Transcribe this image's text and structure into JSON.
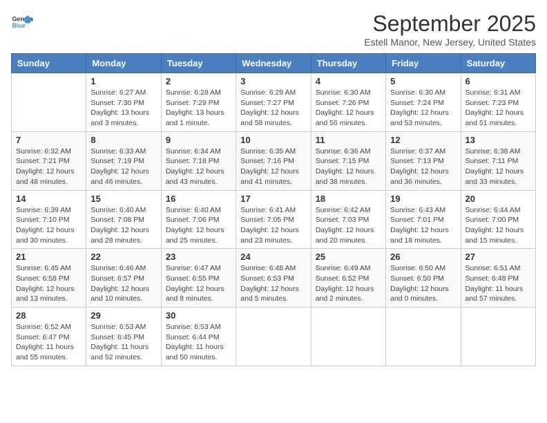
{
  "logo": {
    "text_general": "General",
    "text_blue": "Blue"
  },
  "header": {
    "month": "September 2025",
    "location": "Estell Manor, New Jersey, United States"
  },
  "days_of_week": [
    "Sunday",
    "Monday",
    "Tuesday",
    "Wednesday",
    "Thursday",
    "Friday",
    "Saturday"
  ],
  "weeks": [
    [
      {
        "day": "",
        "info": ""
      },
      {
        "day": "1",
        "info": "Sunrise: 6:27 AM\nSunset: 7:30 PM\nDaylight: 13 hours\nand 3 minutes."
      },
      {
        "day": "2",
        "info": "Sunrise: 6:28 AM\nSunset: 7:29 PM\nDaylight: 13 hours\nand 1 minute."
      },
      {
        "day": "3",
        "info": "Sunrise: 6:29 AM\nSunset: 7:27 PM\nDaylight: 12 hours\nand 58 minutes."
      },
      {
        "day": "4",
        "info": "Sunrise: 6:30 AM\nSunset: 7:26 PM\nDaylight: 12 hours\nand 56 minutes."
      },
      {
        "day": "5",
        "info": "Sunrise: 6:30 AM\nSunset: 7:24 PM\nDaylight: 12 hours\nand 53 minutes."
      },
      {
        "day": "6",
        "info": "Sunrise: 6:31 AM\nSunset: 7:23 PM\nDaylight: 12 hours\nand 51 minutes."
      }
    ],
    [
      {
        "day": "7",
        "info": "Sunrise: 6:32 AM\nSunset: 7:21 PM\nDaylight: 12 hours\nand 48 minutes."
      },
      {
        "day": "8",
        "info": "Sunrise: 6:33 AM\nSunset: 7:19 PM\nDaylight: 12 hours\nand 46 minutes."
      },
      {
        "day": "9",
        "info": "Sunrise: 6:34 AM\nSunset: 7:18 PM\nDaylight: 12 hours\nand 43 minutes."
      },
      {
        "day": "10",
        "info": "Sunrise: 6:35 AM\nSunset: 7:16 PM\nDaylight: 12 hours\nand 41 minutes."
      },
      {
        "day": "11",
        "info": "Sunrise: 6:36 AM\nSunset: 7:15 PM\nDaylight: 12 hours\nand 38 minutes."
      },
      {
        "day": "12",
        "info": "Sunrise: 6:37 AM\nSunset: 7:13 PM\nDaylight: 12 hours\nand 36 minutes."
      },
      {
        "day": "13",
        "info": "Sunrise: 6:38 AM\nSunset: 7:11 PM\nDaylight: 12 hours\nand 33 minutes."
      }
    ],
    [
      {
        "day": "14",
        "info": "Sunrise: 6:39 AM\nSunset: 7:10 PM\nDaylight: 12 hours\nand 30 minutes."
      },
      {
        "day": "15",
        "info": "Sunrise: 6:40 AM\nSunset: 7:08 PM\nDaylight: 12 hours\nand 28 minutes."
      },
      {
        "day": "16",
        "info": "Sunrise: 6:40 AM\nSunset: 7:06 PM\nDaylight: 12 hours\nand 25 minutes."
      },
      {
        "day": "17",
        "info": "Sunrise: 6:41 AM\nSunset: 7:05 PM\nDaylight: 12 hours\nand 23 minutes."
      },
      {
        "day": "18",
        "info": "Sunrise: 6:42 AM\nSunset: 7:03 PM\nDaylight: 12 hours\nand 20 minutes."
      },
      {
        "day": "19",
        "info": "Sunrise: 6:43 AM\nSunset: 7:01 PM\nDaylight: 12 hours\nand 18 minutes."
      },
      {
        "day": "20",
        "info": "Sunrise: 6:44 AM\nSunset: 7:00 PM\nDaylight: 12 hours\nand 15 minutes."
      }
    ],
    [
      {
        "day": "21",
        "info": "Sunrise: 6:45 AM\nSunset: 6:58 PM\nDaylight: 12 hours\nand 13 minutes."
      },
      {
        "day": "22",
        "info": "Sunrise: 6:46 AM\nSunset: 6:57 PM\nDaylight: 12 hours\nand 10 minutes."
      },
      {
        "day": "23",
        "info": "Sunrise: 6:47 AM\nSunset: 6:55 PM\nDaylight: 12 hours\nand 8 minutes."
      },
      {
        "day": "24",
        "info": "Sunrise: 6:48 AM\nSunset: 6:53 PM\nDaylight: 12 hours\nand 5 minutes."
      },
      {
        "day": "25",
        "info": "Sunrise: 6:49 AM\nSunset: 6:52 PM\nDaylight: 12 hours\nand 2 minutes."
      },
      {
        "day": "26",
        "info": "Sunrise: 6:50 AM\nSunset: 6:50 PM\nDaylight: 12 hours\nand 0 minutes."
      },
      {
        "day": "27",
        "info": "Sunrise: 6:51 AM\nSunset: 6:48 PM\nDaylight: 11 hours\nand 57 minutes."
      }
    ],
    [
      {
        "day": "28",
        "info": "Sunrise: 6:52 AM\nSunset: 6:47 PM\nDaylight: 11 hours\nand 55 minutes."
      },
      {
        "day": "29",
        "info": "Sunrise: 6:53 AM\nSunset: 6:45 PM\nDaylight: 11 hours\nand 52 minutes."
      },
      {
        "day": "30",
        "info": "Sunrise: 6:53 AM\nSunset: 6:44 PM\nDaylight: 11 hours\nand 50 minutes."
      },
      {
        "day": "",
        "info": ""
      },
      {
        "day": "",
        "info": ""
      },
      {
        "day": "",
        "info": ""
      },
      {
        "day": "",
        "info": ""
      }
    ]
  ]
}
